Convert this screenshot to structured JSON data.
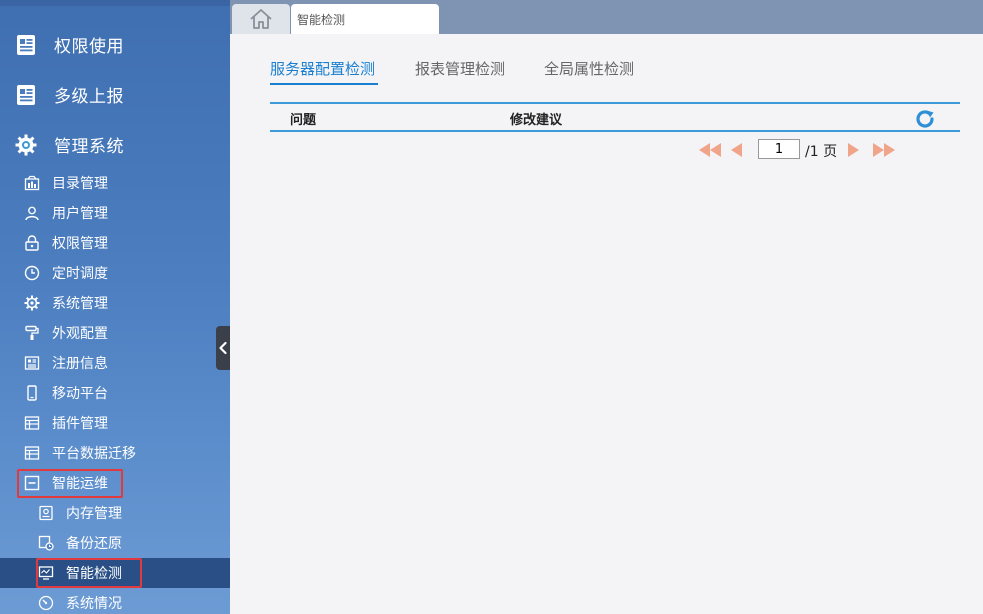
{
  "sidebar": {
    "main_items": [
      {
        "label": "权限使用",
        "icon": "report-list-icon"
      },
      {
        "label": "多级上报",
        "icon": "report-list-icon"
      },
      {
        "label": "管理系统",
        "icon": "gear-icon"
      }
    ],
    "sub_items": [
      {
        "label": "目录管理",
        "icon": "catalog-icon"
      },
      {
        "label": "用户管理",
        "icon": "user-icon"
      },
      {
        "label": "权限管理",
        "icon": "lock-icon"
      },
      {
        "label": "定时调度",
        "icon": "clock-icon"
      },
      {
        "label": "系统管理",
        "icon": "gear-icon"
      },
      {
        "label": "外观配置",
        "icon": "paint-roller-icon"
      },
      {
        "label": "注册信息",
        "icon": "registration-icon"
      },
      {
        "label": "移动平台",
        "icon": "mobile-icon"
      },
      {
        "label": "插件管理",
        "icon": "plugin-icon"
      },
      {
        "label": "平台数据迁移",
        "icon": "data-migration-icon"
      },
      {
        "label": "智能运维",
        "icon": "collapse-minus-icon"
      }
    ],
    "sub_sub_items": [
      {
        "label": "内存管理",
        "icon": "memory-icon"
      },
      {
        "label": "备份还原",
        "icon": "backup-icon"
      },
      {
        "label": "智能检测",
        "icon": "monitor-icon",
        "active": true
      },
      {
        "label": "系统情况",
        "icon": "gauge-icon"
      }
    ]
  },
  "tabs": {
    "home_icon": "home-icon",
    "current": "智能检测"
  },
  "subtabs": [
    {
      "label": "服务器配置检测",
      "active": true
    },
    {
      "label": "报表管理检测",
      "active": false
    },
    {
      "label": "全局属性检测",
      "active": false
    }
  ],
  "table": {
    "columns": [
      "问题",
      "修改建议"
    ],
    "rows": []
  },
  "pager": {
    "current_page": "1",
    "total": "/1 页"
  },
  "colors": {
    "accent": "#1a7fd0",
    "highlight_box": "#e0393e",
    "pager_arrow": "#f0a58a",
    "sidebar_bg": "#4a7cbe"
  }
}
